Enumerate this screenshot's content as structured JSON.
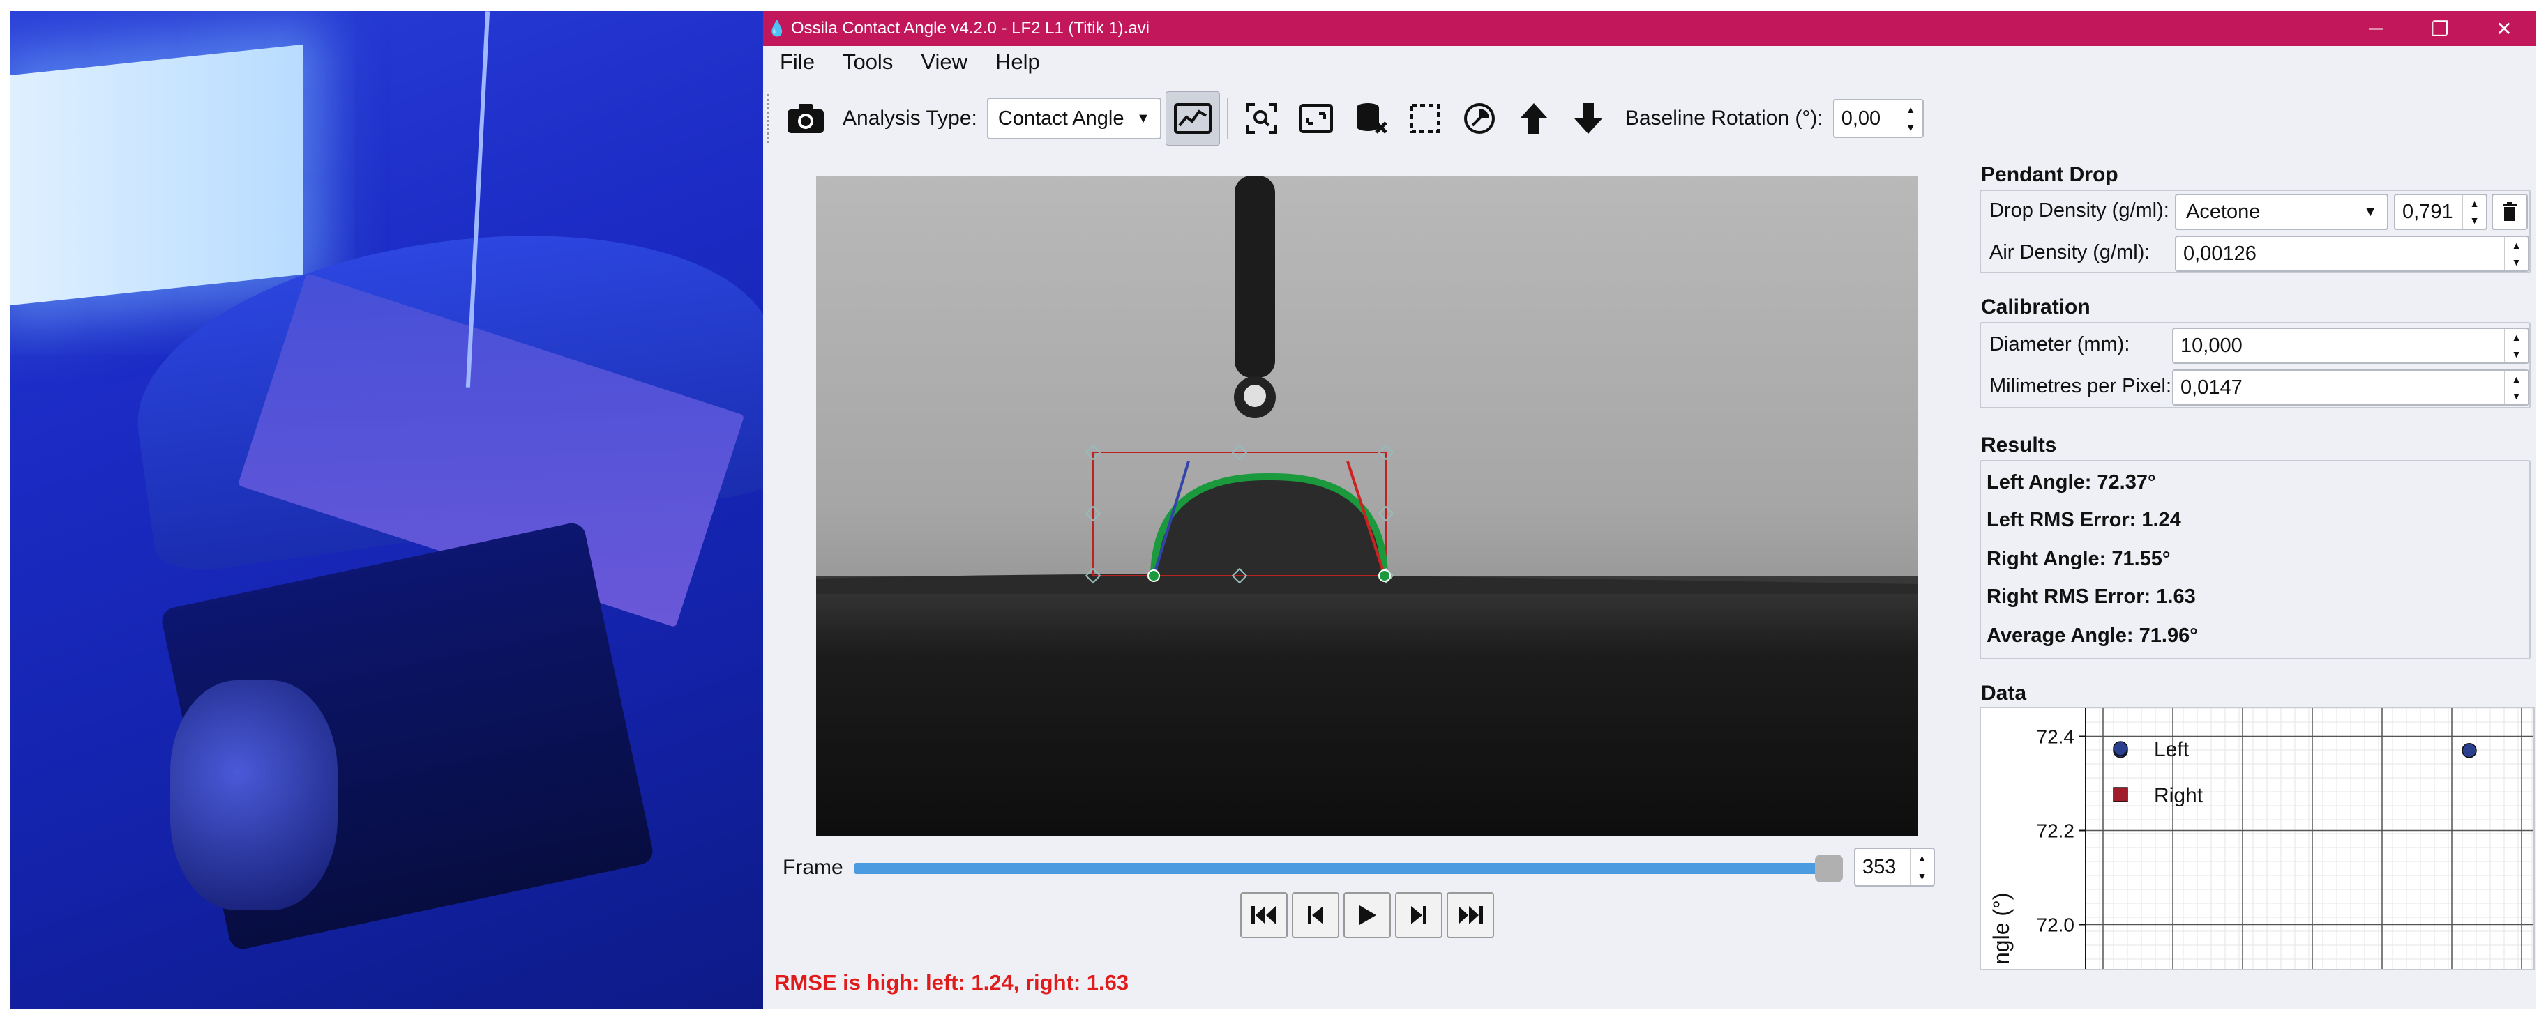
{
  "window": {
    "title": "Ossila Contact Angle v4.2.0 - LF2 L1 (Titik 1).avi",
    "minimize": "─",
    "restore": "❐",
    "close": "✕"
  },
  "menu": [
    "File",
    "Tools",
    "View",
    "Help"
  ],
  "toolbar": {
    "analysis_type_label": "Analysis Type:",
    "analysis_type_value": "Contact Angle",
    "baseline_rotation_label": "Baseline Rotation (°):",
    "baseline_rotation_value": "0,00",
    "icons": [
      "camera-icon",
      "analysis-graph-icon",
      "zoom-fit-icon",
      "fullscreen-icon",
      "clear-data-icon",
      "crop-region-icon",
      "auto-detect-icon",
      "move-up-icon",
      "move-down-icon"
    ]
  },
  "frame": {
    "label": "Frame",
    "value": "353",
    "progress": 0.99
  },
  "playback": [
    "first-frame-icon",
    "previous-frame-icon",
    "play-icon",
    "next-frame-icon",
    "last-frame-icon"
  ],
  "status": "RMSE is high: left: 1.24, right: 1.63",
  "pendant_drop": {
    "title": "Pendant Drop",
    "drop_density_label": "Drop Density (g/ml):",
    "drop_density_liquid": "Acetone",
    "drop_density_value": "0,791",
    "air_density_label": "Air Density (g/ml):",
    "air_density_value": "0,00126"
  },
  "calibration": {
    "title": "Calibration",
    "diameter_label": "Diameter (mm):",
    "diameter_value": "10,000",
    "mpp_label": "Milimetres per Pixel:",
    "mpp_value": "0,0147"
  },
  "results": {
    "title": "Results",
    "left_angle": "Left Angle: 72.37°",
    "left_rms": "Left RMS Error: 1.24",
    "right_angle": "Right Angle: 71.55°",
    "right_rms": "Right RMS Error: 1.63",
    "average_angle": "Average Angle: 71.96°"
  },
  "data_section_title": "Data",
  "chart_data": {
    "type": "scatter",
    "ylabel": "ngle (°)",
    "y_ticks": [
      "72.4",
      "72.2",
      "72.0"
    ],
    "ylim": [
      71.9,
      72.46
    ],
    "grid": true,
    "legend_placement": "top-left",
    "series": [
      {
        "name": "Left",
        "color": "#2b3f8f",
        "marker": "circle",
        "x": [
          0,
          1
        ],
        "values": [
          72.37,
          72.37
        ]
      },
      {
        "name": "Right",
        "color": "#a11c2a",
        "marker": "square",
        "x": [],
        "values": []
      }
    ]
  },
  "colors": {
    "titlebar": "#c2185b",
    "status_error": "#e01b1b",
    "slider_fill": "#4a9be0",
    "fit_curve": "#1a9a3c"
  }
}
